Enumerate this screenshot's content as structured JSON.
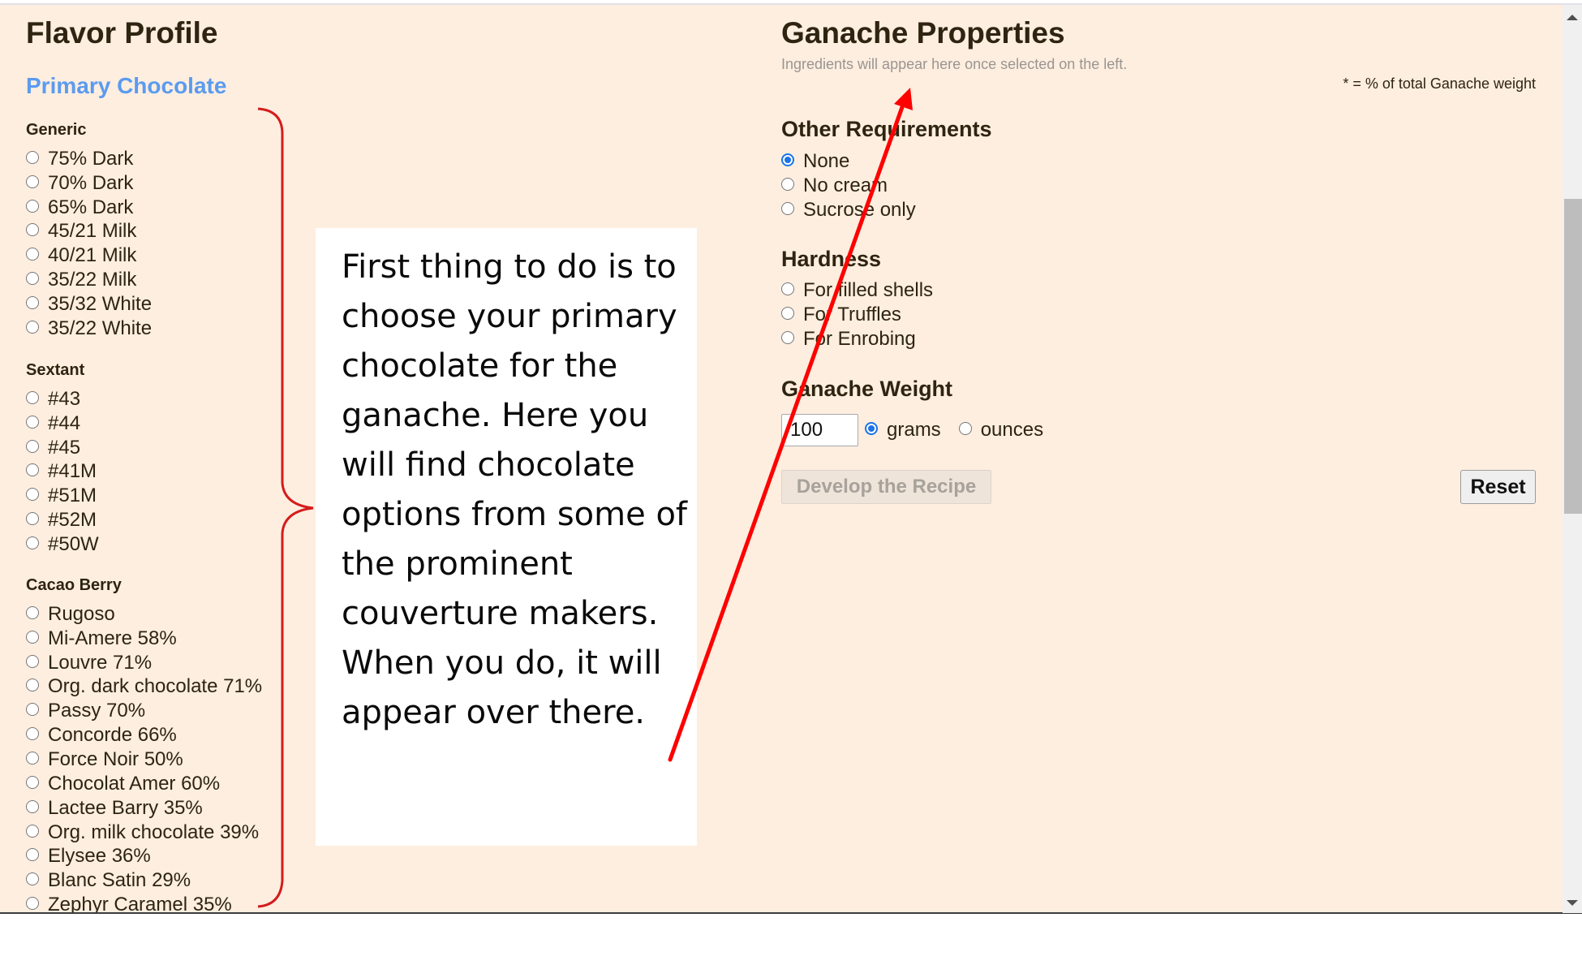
{
  "left": {
    "title": "Flavor Profile",
    "subtitle": "Primary Chocolate",
    "groups": [
      {
        "heading": "Generic",
        "options": [
          "75% Dark",
          "70% Dark",
          "65% Dark",
          "45/21 Milk",
          "40/21 Milk",
          "35/22 Milk",
          "35/32 White",
          "35/22 White"
        ]
      },
      {
        "heading": "Sextant",
        "options": [
          "#43",
          "#44",
          "#45",
          "#41M",
          "#51M",
          "#52M",
          "#50W"
        ]
      },
      {
        "heading": "Cacao Berry",
        "options": [
          "Rugoso",
          "Mi-Amere 58%",
          "Louvre 71%",
          "Org. dark chocolate 71%",
          "Passy 70%",
          "Concorde 66%",
          "Force Noir 50%",
          "Chocolat Amer 60%",
          "Lactee Barry 35%",
          "Org. milk chocolate 39%",
          "Elysee 36%",
          "Blanc Satin 29%",
          "Zephyr Caramel 35%"
        ]
      }
    ]
  },
  "right": {
    "title": "Ganache Properties",
    "hint": "Ingredients will appear here once selected on the left.",
    "footnote": "* = % of total Ganache weight",
    "other_requirements": {
      "heading": "Other Requirements",
      "options": [
        "None",
        "No cream",
        "Sucrose only"
      ],
      "selected": "None"
    },
    "hardness": {
      "heading": "Hardness",
      "options": [
        "For filled shells",
        "For Truffles",
        "For Enrobing"
      ],
      "selected": null
    },
    "weight": {
      "heading": "Ganache Weight",
      "value": "100",
      "units": [
        "grams",
        "ounces"
      ],
      "selected_unit": "grams"
    },
    "develop_label": "Develop the Recipe",
    "develop_disabled": true,
    "reset_label": "Reset"
  },
  "annotation": {
    "text": "First thing to do is to choose your primary chocolate for the ganache. Here you will find chocolate options from some of the prominent couverture makers. When you do, it will appear over there.",
    "color": "#ff0000"
  },
  "colors": {
    "page_bg": "#fdeee0",
    "accent_blue": "#5b9bef",
    "text_dark": "#2e2410",
    "radio_checked": "#1a73e8"
  }
}
